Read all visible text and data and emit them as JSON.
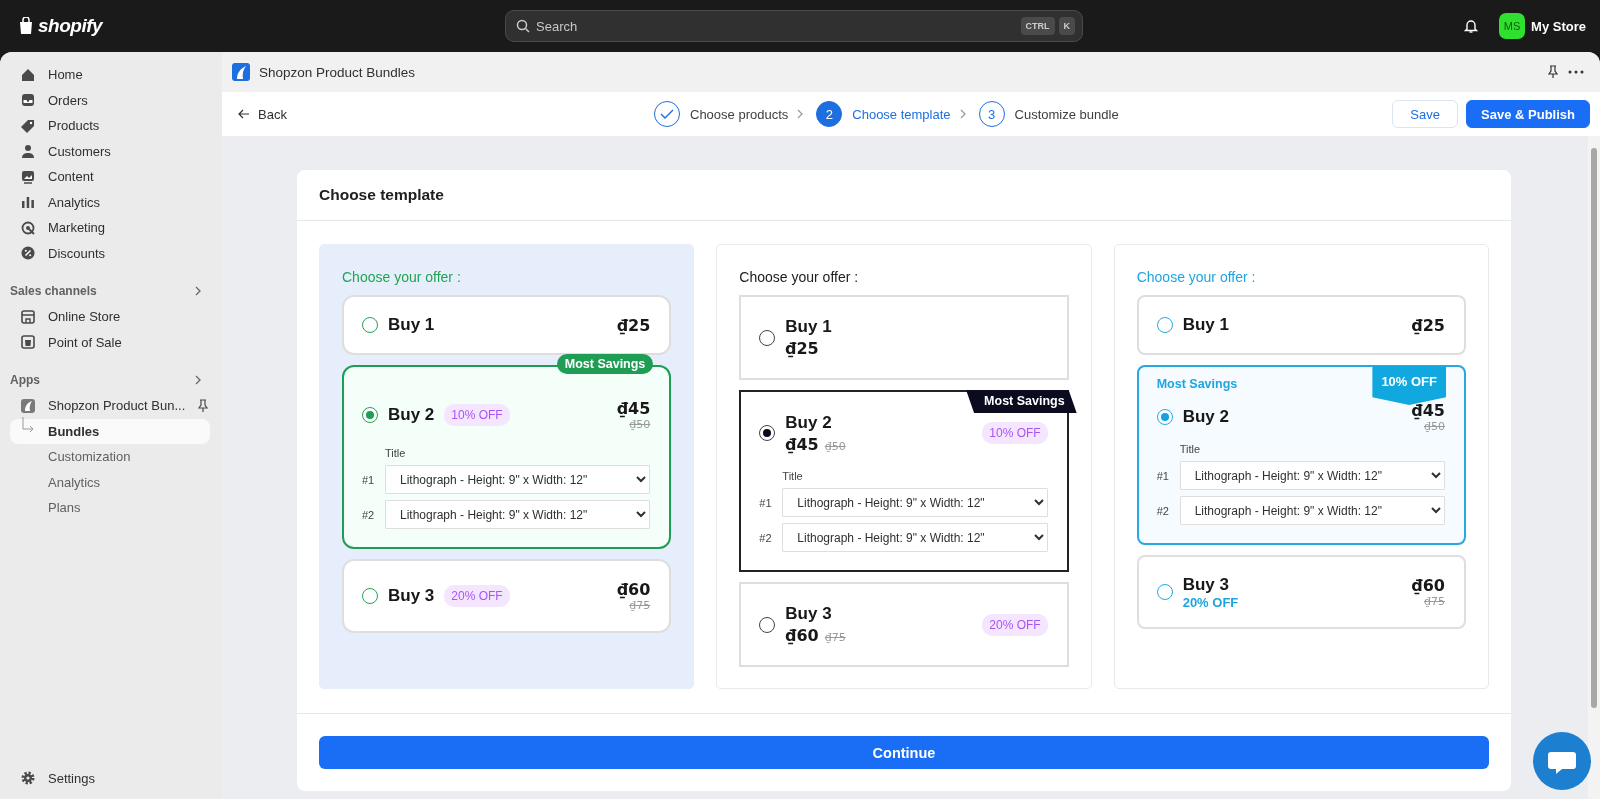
{
  "topbar": {
    "logo": "shopify",
    "search": {
      "placeholder": "Search",
      "keys": [
        "CTRL",
        "K"
      ]
    },
    "store": {
      "initials": "MS",
      "name": "My Store"
    }
  },
  "sidebar": {
    "items": [
      {
        "label": "Home",
        "selected": false
      },
      {
        "label": "Orders",
        "selected": false
      },
      {
        "label": "Products",
        "selected": false
      },
      {
        "label": "Customers",
        "selected": false
      },
      {
        "label": "Content",
        "selected": false
      },
      {
        "label": "Analytics",
        "selected": false
      },
      {
        "label": "Marketing",
        "selected": false
      },
      {
        "label": "Discounts",
        "selected": false
      }
    ],
    "sections": [
      {
        "title": "Sales channels",
        "items": [
          {
            "label": "Online Store",
            "selected": false
          },
          {
            "label": "Point of Sale",
            "selected": false
          }
        ]
      },
      {
        "title": "Apps",
        "items": [
          {
            "label": "Shopzon Product Bun...",
            "selected": false,
            "children": [
              {
                "label": "Bundles",
                "selected": true
              },
              {
                "label": "Customization",
                "selected": false
              },
              {
                "label": "Analytics",
                "selected": false
              },
              {
                "label": "Plans",
                "selected": false
              }
            ]
          }
        ]
      }
    ],
    "footer": {
      "label": "Settings"
    }
  },
  "app_header": {
    "title": "Shopzon Product Bundles"
  },
  "toolbar": {
    "back": "Back",
    "steps": [
      {
        "label": "Choose products",
        "done": true,
        "selected": false
      },
      {
        "number": "2",
        "label": "Choose template",
        "done": false,
        "selected": true
      },
      {
        "number": "3",
        "label": "Customize bundle",
        "done": false,
        "selected": false
      }
    ],
    "buttons": [
      {
        "label": "Save",
        "kind": "secondary"
      },
      {
        "label": "Save & Publish",
        "kind": "primary"
      }
    ]
  },
  "card": {
    "title": "Choose template",
    "templates": [
      {
        "kind": "pill",
        "selected": true,
        "heading": "Choose your offer :",
        "offers": [
          {
            "label": "Buy 1",
            "price": "₫25",
            "selected": false
          },
          {
            "label": "Buy 2",
            "discount": "10% OFF",
            "price": "₫45",
            "old_price": "₫50",
            "selected": true,
            "badge": "Most Savings",
            "title_label": "Title",
            "variants": [
              {
                "index": "#1",
                "value": "Lithograph - Height: 9\" x Width: 12\""
              },
              {
                "index": "#2",
                "value": "Lithograph - Height: 9\" x Width: 12\""
              }
            ]
          },
          {
            "label": "Buy 3",
            "discount": "20% OFF",
            "price": "₫60",
            "old_price": "₫75",
            "selected": false
          }
        ]
      },
      {
        "kind": "ribbon",
        "selected": false,
        "heading": "Choose your offer :",
        "offers": [
          {
            "label": "Buy 1",
            "price": "₫25",
            "selected": false
          },
          {
            "label": "Buy 2",
            "discount": "10% OFF",
            "price": "₫45",
            "old_price": "₫50",
            "selected": true,
            "badge": "Most Savings",
            "title_label": "Title",
            "variants": [
              {
                "index": "#1",
                "value": "Lithograph - Height: 9\" x Width: 12\""
              },
              {
                "index": "#2",
                "value": "Lithograph - Height: 9\" x Width: 12\""
              }
            ]
          },
          {
            "label": "Buy 3",
            "discount": "20% OFF",
            "price": "₫60",
            "old_price": "₫75",
            "selected": false
          }
        ]
      },
      {
        "kind": "banner",
        "selected": false,
        "heading": "Choose your offer :",
        "offers": [
          {
            "label": "Buy 1",
            "price": "₫25",
            "selected": false
          },
          {
            "label": "Buy 2",
            "discount": "10% OFF",
            "price": "₫45",
            "old_price": "₫50",
            "selected": true,
            "badge": "Most Savings",
            "title_label": "Title",
            "variants": [
              {
                "index": "#1",
                "value": "Lithograph - Height: 9\" x Width: 12\""
              },
              {
                "index": "#2",
                "value": "Lithograph - Height: 9\" x Width: 12\""
              }
            ]
          },
          {
            "label": "Buy 3",
            "discount": "20% OFF",
            "price": "₫60",
            "old_price": "₫75",
            "selected": false
          }
        ]
      }
    ],
    "continue": "Continue"
  }
}
